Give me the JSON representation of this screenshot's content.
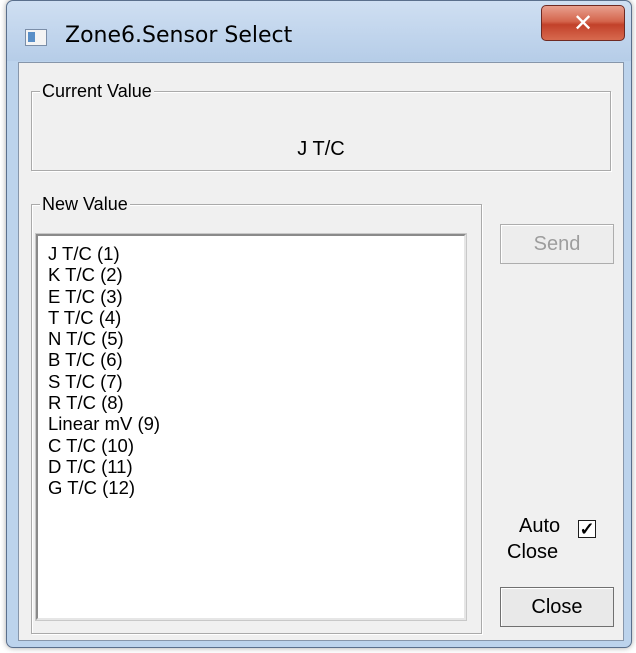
{
  "window": {
    "title": "Zone6.Sensor Select",
    "close_glyph": "✕"
  },
  "current_value": {
    "label": "Current Value",
    "value": "J T/C"
  },
  "new_value": {
    "label": "New Value",
    "items": [
      "J T/C (1)",
      "K T/C (2)",
      "E T/C (3)",
      "T T/C (4)",
      "N T/C (5)",
      "B T/C (6)",
      "S T/C (7)",
      "R T/C (8)",
      "Linear mV (9)",
      "C T/C (10)",
      "D T/C (11)",
      "G T/C (12)"
    ]
  },
  "buttons": {
    "send_label": "Send",
    "close_label": "Close"
  },
  "auto_close": {
    "line1": "Auto",
    "line2": "Close",
    "checked": true,
    "check_glyph": "✓"
  },
  "icons": {
    "app": "window-app-icon",
    "close": "close-x-icon",
    "check": "checkmark-icon"
  },
  "colors": {
    "title_close_red": "#c2412a",
    "frame_blue": "#bcd3ec",
    "dialog_bg": "#f0f0f0"
  }
}
